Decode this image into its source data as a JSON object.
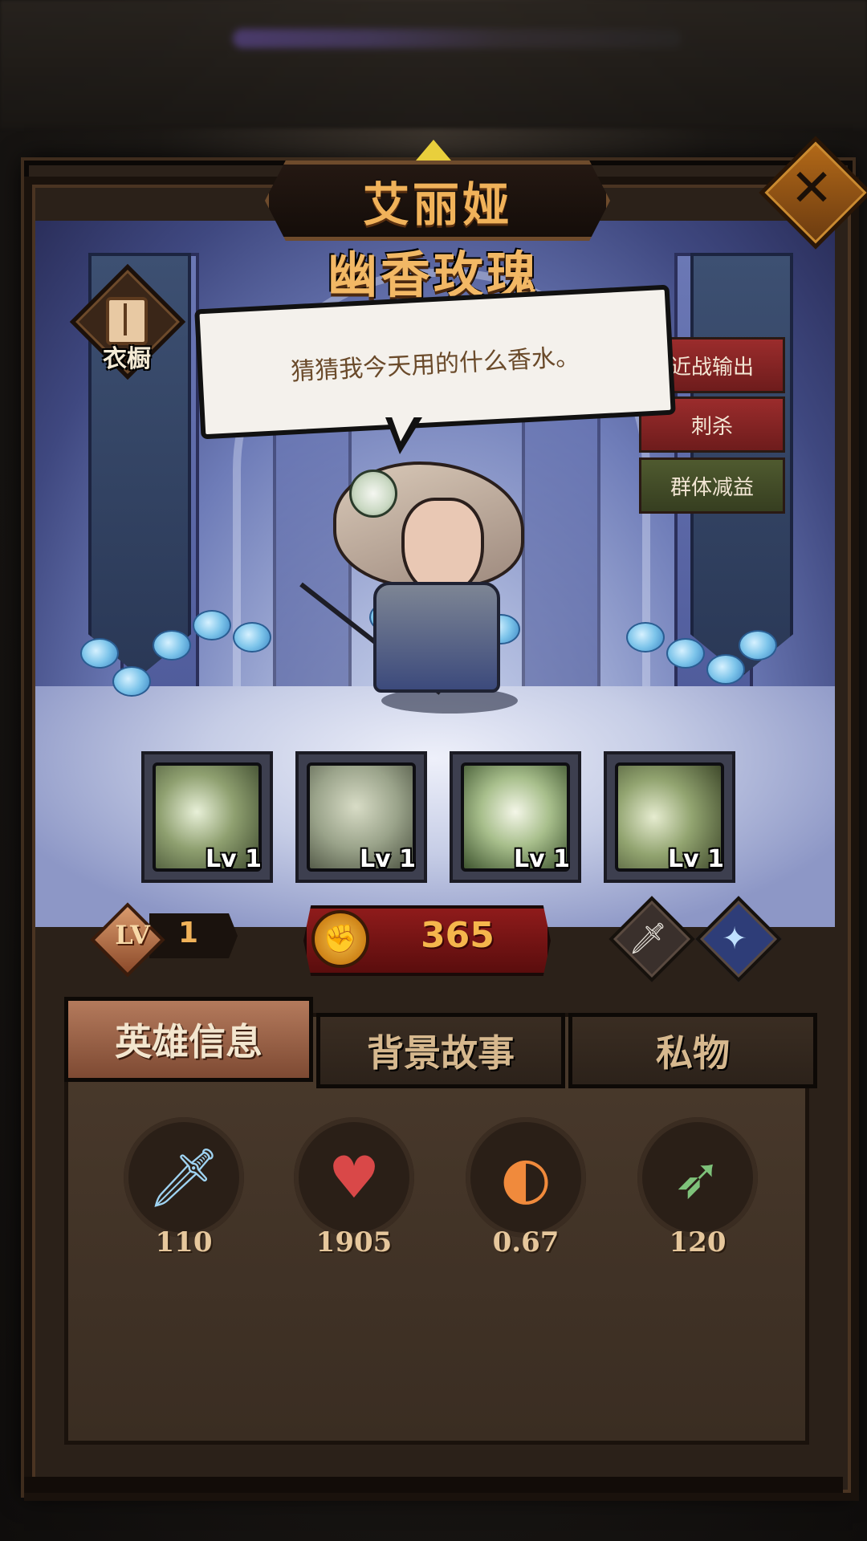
{
  "hero": {
    "name": "艾丽娅",
    "skin_name": "幽香玫瑰",
    "dialogue": "猜猜我今天用的什么香水。",
    "wardrobe_label": "衣橱",
    "tags": [
      "近战输出",
      "刺杀",
      "群体减益"
    ],
    "level_badge": "LV",
    "level": "1",
    "power": "365"
  },
  "skills": [
    {
      "level_label": "Lv 1",
      "icon": "spear-strike-icon"
    },
    {
      "level_label": "Lv 1",
      "icon": "petal-storm-icon"
    },
    {
      "level_label": "Lv 1",
      "icon": "white-rose-icon"
    },
    {
      "level_label": "Lv 1",
      "icon": "whirlwind-dash-icon"
    }
  ],
  "tabs": [
    "英雄信息",
    "背景故事",
    "私物"
  ],
  "active_tab": "英雄信息",
  "stats": [
    {
      "icon": "sword-icon",
      "value": "110"
    },
    {
      "icon": "heart-icon",
      "value": "1905"
    },
    {
      "icon": "attack-speed-icon",
      "value": "0.67"
    },
    {
      "icon": "range-arrow-icon",
      "value": "120"
    }
  ],
  "colors": {
    "title_gold": "#f0b25a",
    "tag_red": "#9b2c2c",
    "tag_green": "#4f5a2f",
    "power_red": "#8f1b1b"
  }
}
